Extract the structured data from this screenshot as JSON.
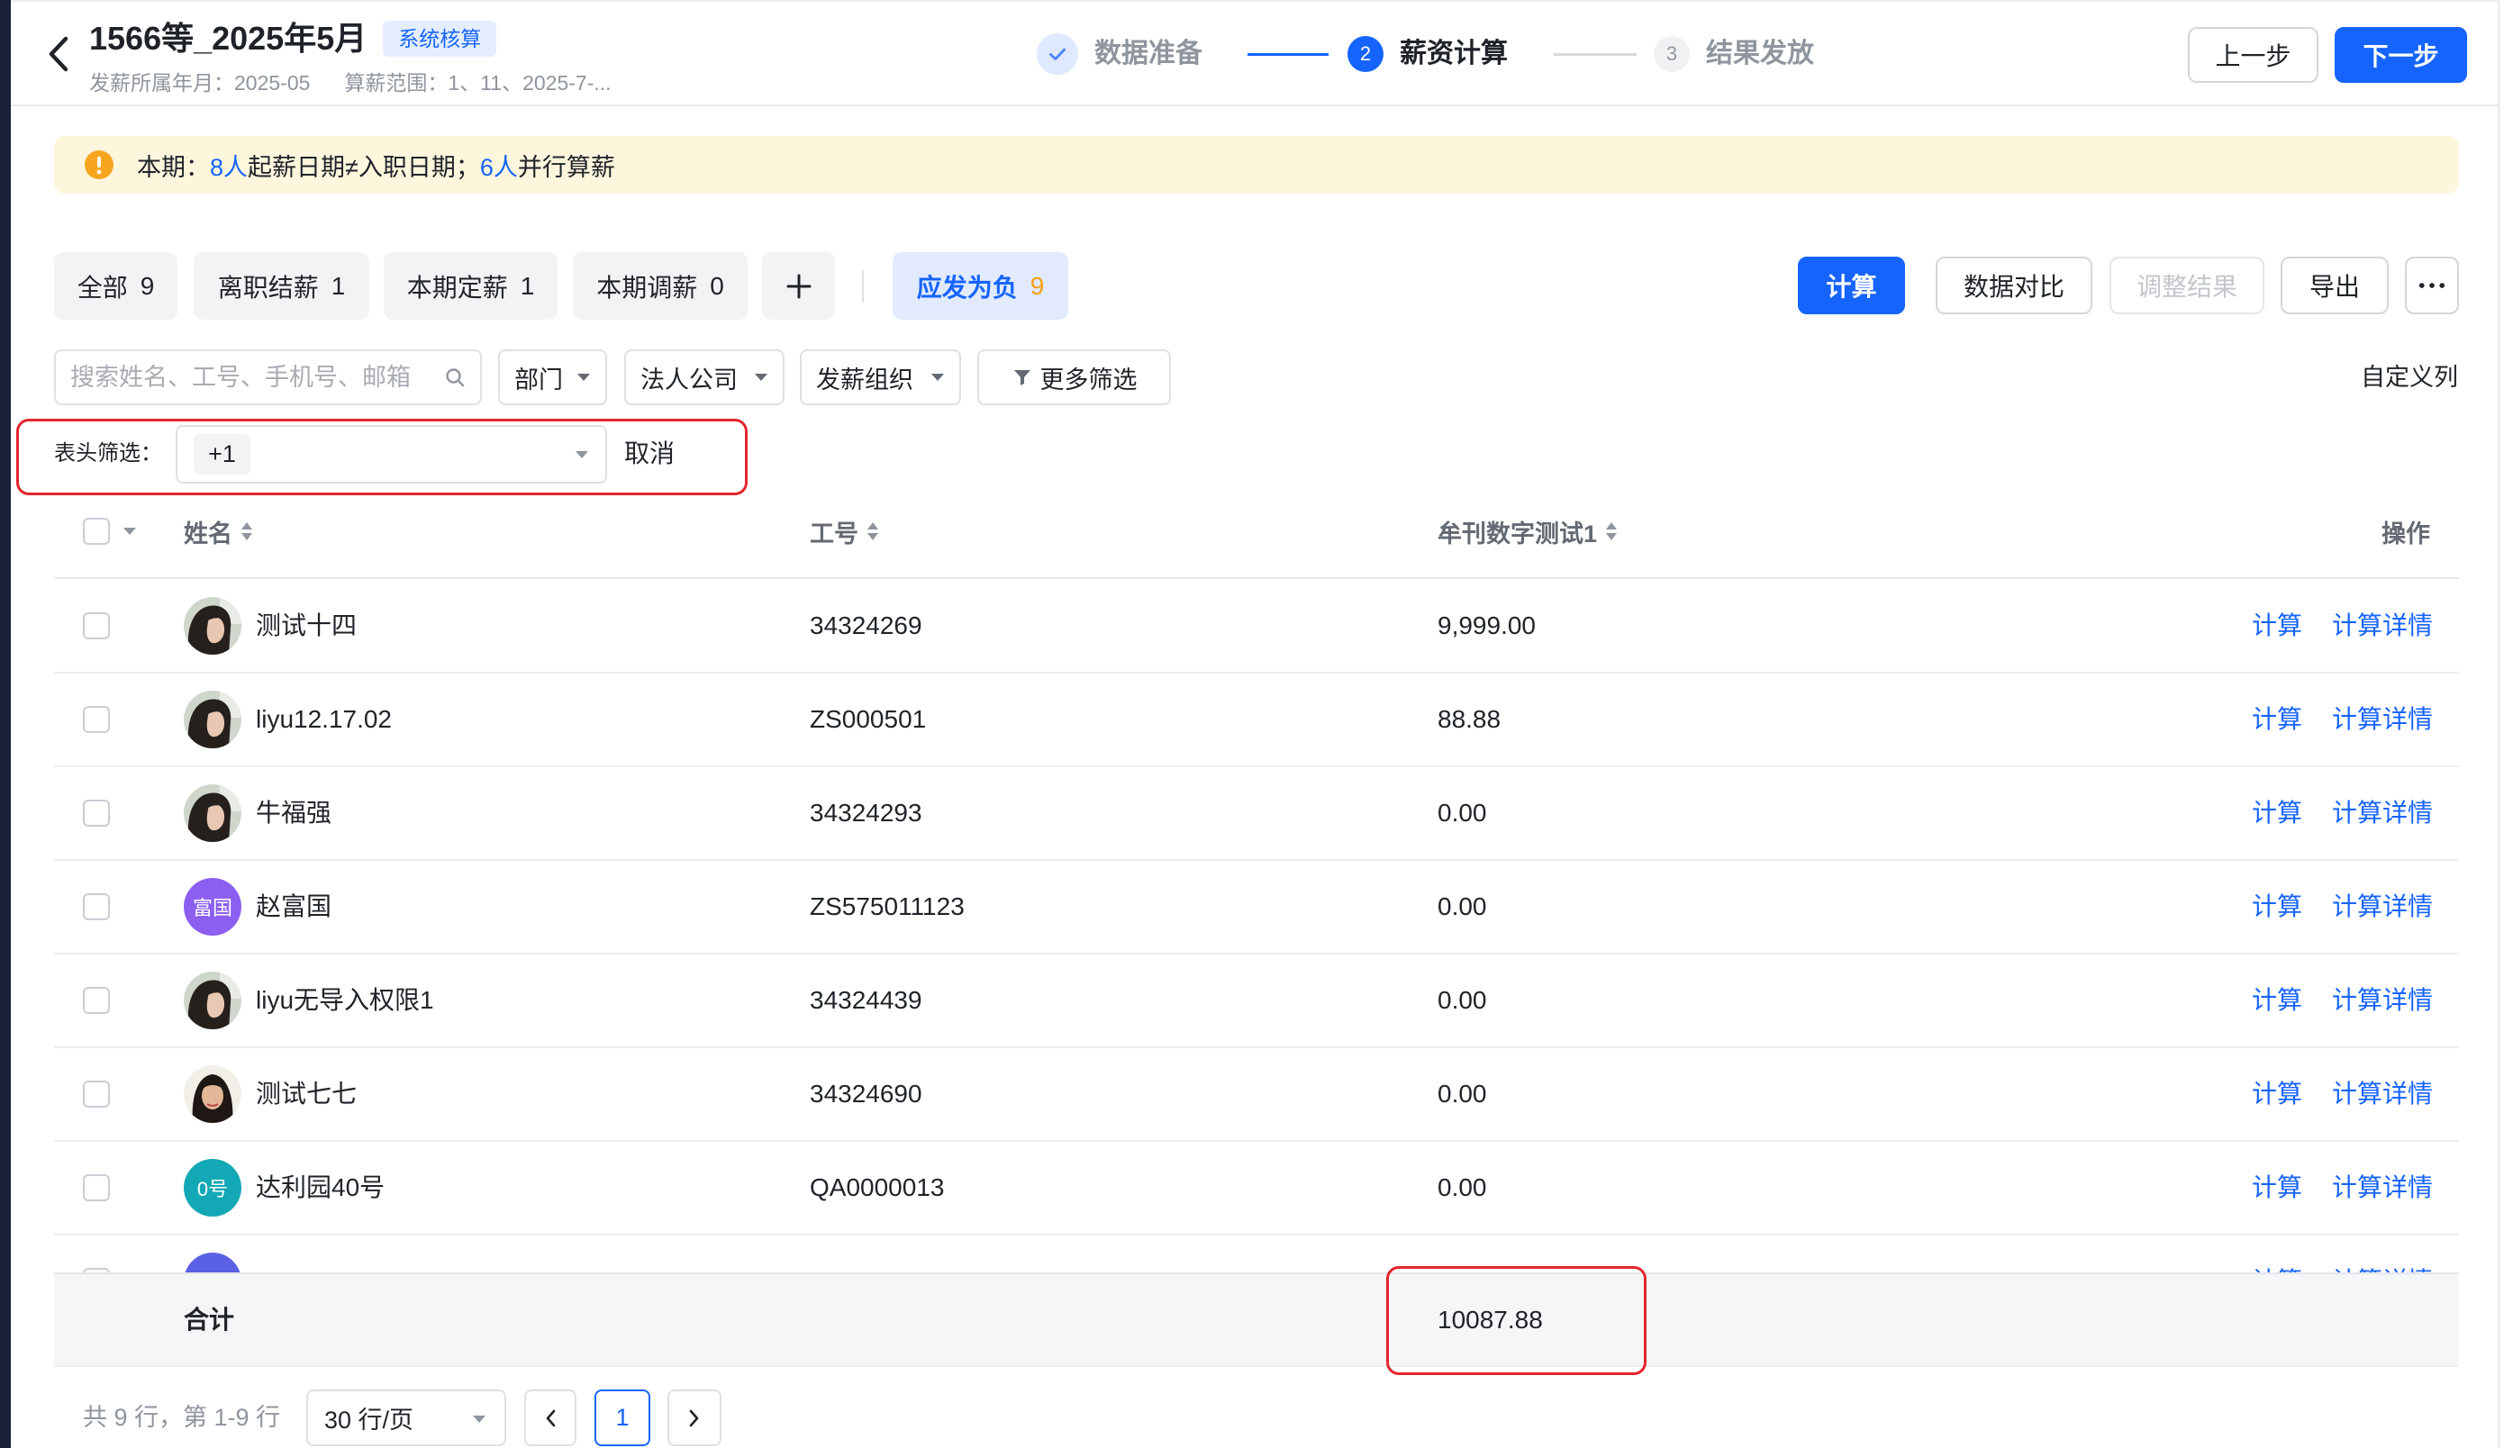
{
  "header": {
    "title": "1566等_2025年5月",
    "badge": "系统核算",
    "period_label": "发薪所属年月：",
    "period_value": "2025-05",
    "scope_label": "算薪范围：",
    "scope_value": "1、11、2025-7-...",
    "steps": [
      {
        "label": "数据准备",
        "status": "done"
      },
      {
        "number": "2",
        "label": "薪资计算",
        "status": "active"
      },
      {
        "number": "3",
        "label": "结果发放",
        "status": "pending"
      }
    ],
    "prev_button": "上一步",
    "next_button": "下一步"
  },
  "notice": {
    "prefix": "本期：",
    "link1": "8人",
    "text1": "起薪日期≠入职日期；",
    "link2": "6人",
    "text2": "并行算薪"
  },
  "tabs": [
    {
      "label": "全部",
      "count": "9"
    },
    {
      "label": "离职结薪",
      "count": "1"
    },
    {
      "label": "本期定薪",
      "count": "1"
    },
    {
      "label": "本期调薪",
      "count": "0"
    }
  ],
  "quick_filter": {
    "label": "应发为负",
    "count": "9"
  },
  "toolbar": {
    "calculate": "计算",
    "compare": "数据对比",
    "adjust": "调整结果",
    "export": "导出"
  },
  "filters": {
    "search_placeholder": "搜索姓名、工号、手机号、邮箱",
    "department": "部门",
    "legal_entity": "法人公司",
    "payroll_org": "发薪组织",
    "more_filters": "更多筛选",
    "custom_columns": "自定义列"
  },
  "header_filter": {
    "label": "表头筛选：",
    "tag": "+1",
    "cancel": "取消"
  },
  "table": {
    "columns": [
      "姓名",
      "工号",
      "牟刊数字测试1",
      "操作"
    ],
    "row_actions": [
      "计算",
      "计算详情"
    ],
    "rows": [
      {
        "name": "测试十四",
        "employee_id": "34324269",
        "value": "9,999.00",
        "avatar": {
          "kind": "photo-a"
        }
      },
      {
        "name": "liyu12.17.02",
        "employee_id": "ZS000501",
        "value": "88.88",
        "avatar": {
          "kind": "photo-a"
        }
      },
      {
        "name": "牛福强",
        "employee_id": "34324293",
        "value": "0.00",
        "avatar": {
          "kind": "photo-a"
        }
      },
      {
        "name": "赵富国",
        "employee_id": "ZS575011123",
        "value": "0.00",
        "avatar": {
          "kind": "text",
          "text": "富国",
          "color": "#8c5ff0"
        }
      },
      {
        "name": "liyu无导入权限1",
        "employee_id": "34324439",
        "value": "0.00",
        "avatar": {
          "kind": "photo-a"
        }
      },
      {
        "name": "测试七七",
        "employee_id": "34324690",
        "value": "0.00",
        "avatar": {
          "kind": "photo-b"
        }
      },
      {
        "name": "达利园40号",
        "employee_id": "QA0000013",
        "value": "0.00",
        "avatar": {
          "kind": "text",
          "text": "0号",
          "color": "#13a8b5"
        }
      },
      {
        "name": "",
        "employee_id": "",
        "value": "",
        "avatar": {
          "kind": "text",
          "color": "#5b61e5"
        }
      }
    ],
    "summary_label": "合计",
    "summary_value": "10087.88"
  },
  "pagination": {
    "summary": "共 9 行，第 1-9 行",
    "page_size": "30 行/页",
    "current_page": "1"
  },
  "icons": {
    "back": "chevron-left-icon",
    "step_done": "check-icon",
    "notice": "warning-icon",
    "add_tab": "plus-icon",
    "more_actions": "more-icon",
    "search": "search-icon",
    "select": "caret-down-icon",
    "more_filters": "filter-icon",
    "sort": "sort-icon",
    "prev_page": "chevron-left-icon",
    "next_page": "chevron-right-icon"
  },
  "colors": {
    "primary": "#1664ff",
    "warning": "#f7a51e",
    "highlight_border": "#e3262d",
    "quick_filter_count": "#f5a010",
    "notice_background": "#fdf6dc"
  }
}
